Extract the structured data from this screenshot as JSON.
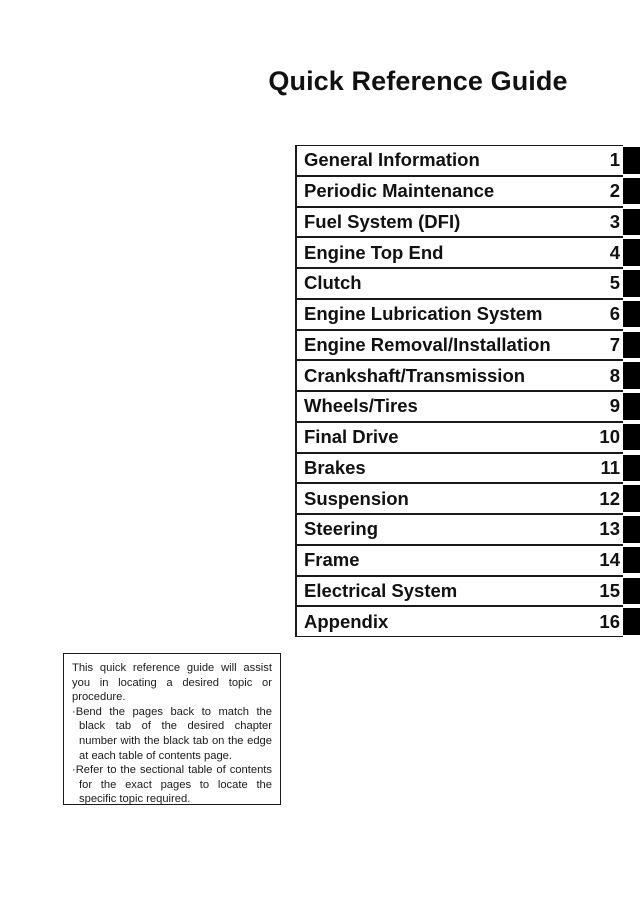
{
  "page": {
    "title": "Quick Reference Guide",
    "background_color": "#ffffff",
    "text_color": "#111111",
    "tab_color": "#000000"
  },
  "index": {
    "rows": [
      {
        "label": "General Information",
        "number": "1"
      },
      {
        "label": "Periodic Maintenance",
        "number": "2"
      },
      {
        "label": "Fuel System (DFI)",
        "number": "3"
      },
      {
        "label": "Engine Top End",
        "number": "4"
      },
      {
        "label": "Clutch",
        "number": "5"
      },
      {
        "label": "Engine Lubrication System",
        "number": "6"
      },
      {
        "label": "Engine Removal/Installation",
        "number": "7"
      },
      {
        "label": "Crankshaft/Transmission",
        "number": "8"
      },
      {
        "label": "Wheels/Tires",
        "number": "9"
      },
      {
        "label": "Final Drive",
        "number": "10"
      },
      {
        "label": "Brakes",
        "number": "11"
      },
      {
        "label": "Suspension",
        "number": "12"
      },
      {
        "label": "Steering",
        "number": "13"
      },
      {
        "label": "Frame",
        "number": "14"
      },
      {
        "label": "Electrical System",
        "number": "15"
      },
      {
        "label": "Appendix",
        "number": "16"
      }
    ]
  },
  "note": {
    "intro": "This quick reference guide will assist you in locating a desired topic or procedure.",
    "bullets": [
      "·Bend the pages back to match the black tab of the desired chapter number with the black tab on the edge at each table of contents page.",
      "·Refer to the sectional table of contents for the exact pages to locate the specific topic required."
    ]
  }
}
